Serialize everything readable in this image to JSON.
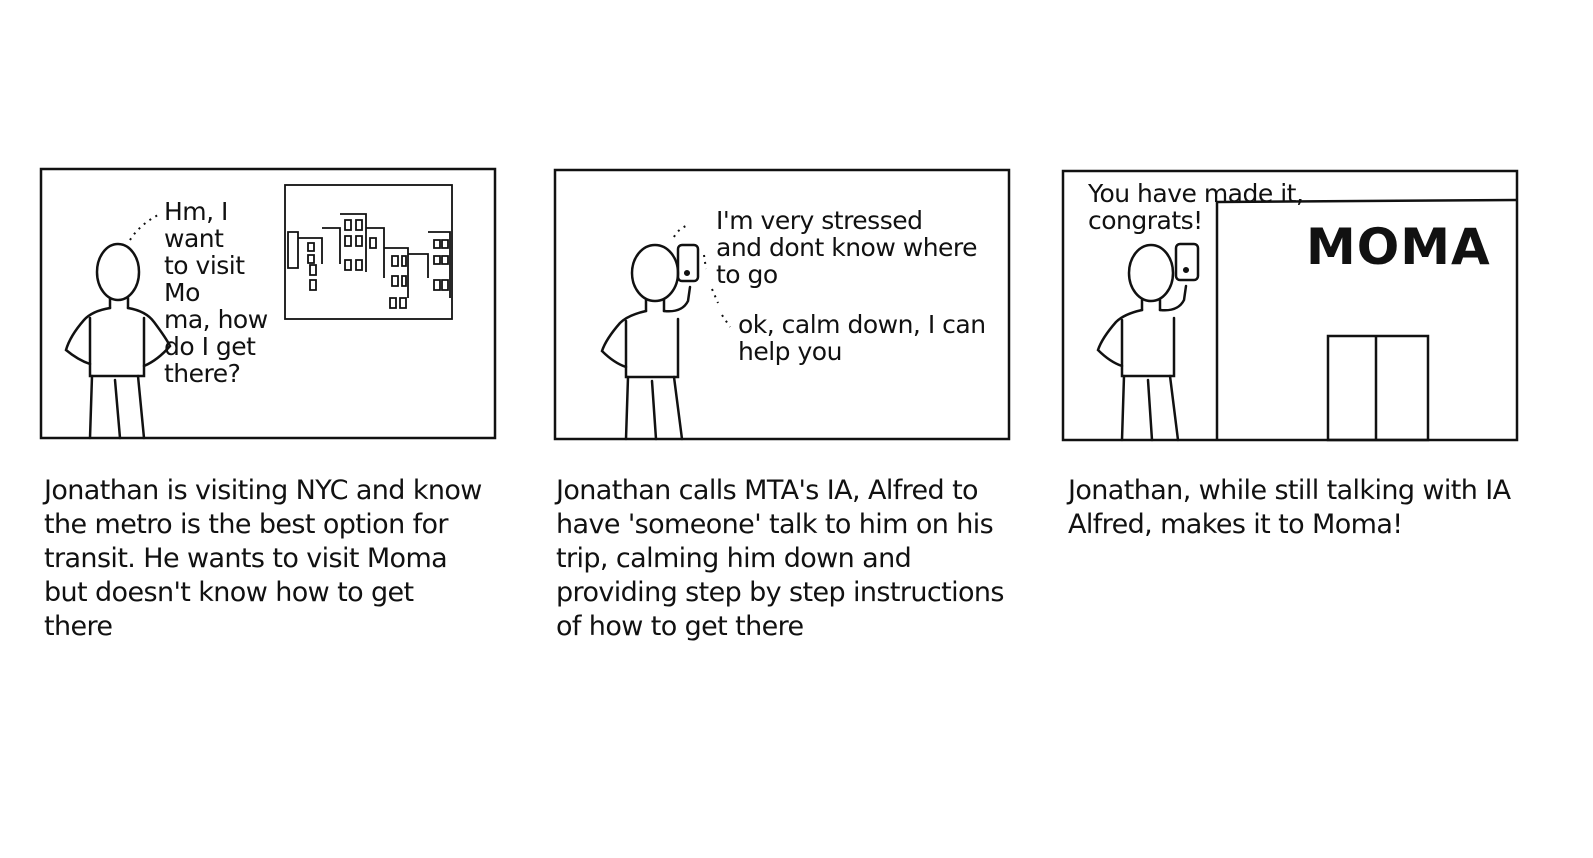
{
  "panels": [
    {
      "speech": "Hm, I want\nto visit Mo\nma, how\ndo I get\nthere?",
      "caption": "Jonathan is visiting NYC and know the metro is the best option for transit. He wants to visit Moma but doesn't know how to get there"
    },
    {
      "speech_user": "I'm very stressed\nand dont know where\nto go",
      "speech_ia": "ok, calm down, I can\nhelp you",
      "caption": "Jonathan calls MTA's IA, Alfred to have 'someone' talk to him on his trip, calming him down and providing step by step instructions of how to get there"
    },
    {
      "speech": "You have made it,\ncongrats!",
      "sign": "MOMA",
      "caption": "Jonathan, while still talking with IA Alfred, makes it to Moma!"
    }
  ],
  "colors": {
    "ink": "#111111",
    "paper": "#ffffff"
  }
}
